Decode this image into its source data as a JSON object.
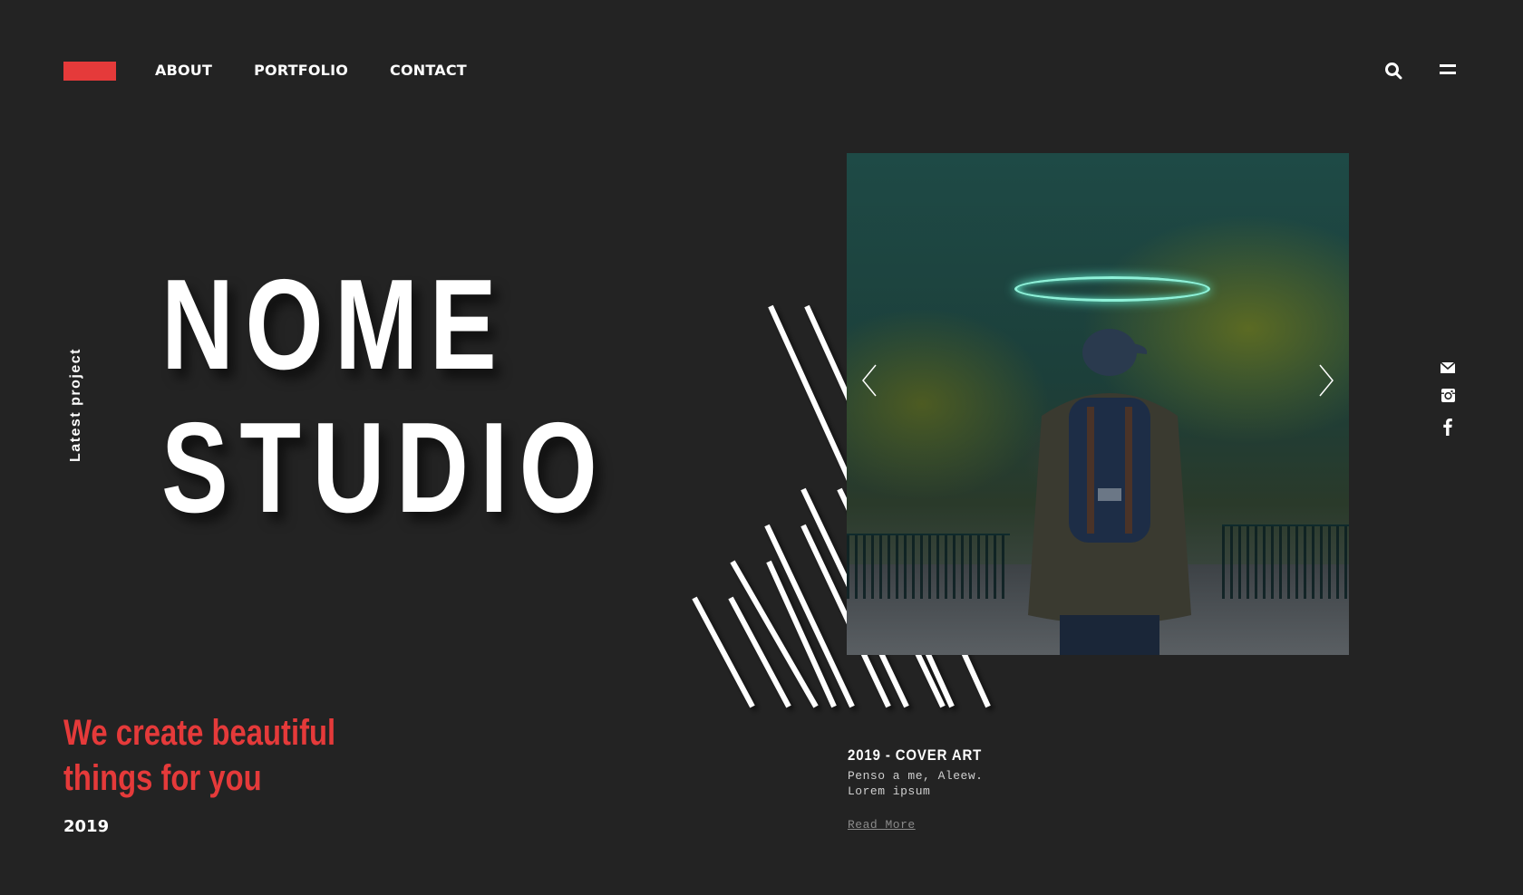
{
  "nav": {
    "items": [
      {
        "label": "ABOUT"
      },
      {
        "label": "PORTFOLIO"
      },
      {
        "label": "CONTACT"
      }
    ]
  },
  "header": {
    "icons": [
      "search-icon",
      "menu-icon"
    ]
  },
  "hero": {
    "vertical_label": "Latest project",
    "title_line1": "NOME",
    "title_line2": "STUDIO",
    "tagline": "We create beautiful things for you",
    "year": "2019"
  },
  "project": {
    "title": "2019 - COVER ART",
    "description": "Penso a me, Aleew.\nLorem ipsum",
    "read_more": "Read More"
  },
  "social": [
    "mail-icon",
    "instagram-icon",
    "facebook-icon"
  ],
  "colors": {
    "background": "#232323",
    "accent": "#e53a3a",
    "text": "#ffffff",
    "halo": "#8ef1d8"
  }
}
